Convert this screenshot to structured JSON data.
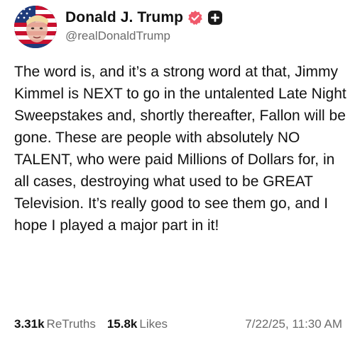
{
  "user": {
    "display_name": "Donald J. Trump",
    "handle": "@realDonaldTrump"
  },
  "post": {
    "text": "The word is, and it’s a strong word at that, Jimmy Kimmel is NEXT to go in the untalented Late Night Sweepstakes and, shortly thereafter, Fallon will be gone. These are people with absolutely NO TALENT, who were paid Millions of Dollars for, in all cases, destroying what used to be GREAT Television. It’s really good to see them go, and I hope I played a major part in it!"
  },
  "stats": {
    "retruths_count": "3.31k",
    "retruths_label": "ReTruths",
    "likes_count": "15.8k",
    "likes_label": "Likes",
    "timestamp": "7/22/25, 11:30 AM"
  },
  "icons": {
    "verified": "verified-badge-icon",
    "plus": "plus-badge-icon"
  },
  "colors": {
    "verified_badge": "#f0596b",
    "plus_badge": "#1a1a1a",
    "muted_text": "#6b6b6b"
  }
}
